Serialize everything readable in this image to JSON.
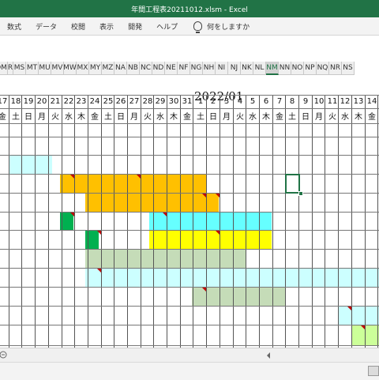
{
  "window": {
    "title": "年間工程表20211012.xlsm  -  Excel"
  },
  "ribbon": {
    "tabs": [
      "数式",
      "データ",
      "校閲",
      "表示",
      "開発",
      "ヘルプ"
    ],
    "tell_me": "何をしますか"
  },
  "sheet": {
    "columns": [
      "QM",
      "R",
      "MS",
      "MT",
      "MU",
      "MV",
      "MW",
      "MX",
      "MY",
      "MZ",
      "NA",
      "NB",
      "NC",
      "ND",
      "NE",
      "NF",
      "NG",
      "NH",
      "NI",
      "NJ",
      "NK",
      "NL",
      "NM",
      "NN",
      "NO",
      "NP",
      "NQ",
      "NR",
      "NS"
    ],
    "selected_column": "NM",
    "month_label": "2022/01",
    "days": [
      "17",
      "18",
      "19",
      "20",
      "21",
      "22",
      "23",
      "24",
      "25",
      "26",
      "27",
      "28",
      "29",
      "30",
      "31",
      "1",
      "2",
      "3",
      "4",
      "5",
      "6",
      "7",
      "8",
      "9",
      "10",
      "11",
      "12",
      "13",
      "14"
    ],
    "weekdays": [
      "金",
      "土",
      "日",
      "月",
      "火",
      "水",
      "木",
      "金",
      "土",
      "日",
      "月",
      "火",
      "水",
      "木",
      "金",
      "土",
      "日",
      "月",
      "火",
      "水",
      "木",
      "金",
      "土",
      "日",
      "月",
      "火",
      "水",
      "木",
      "金"
    ]
  },
  "colors": {
    "excel_green": "#217346",
    "orange": "#ffc000",
    "cyan": "#66ffff",
    "yellow": "#ffff00",
    "sage": "#c5dcb8",
    "lightcyan": "#ccffff",
    "lime": "#ccff99",
    "green": "#00b050",
    "flag": "#c00000"
  }
}
